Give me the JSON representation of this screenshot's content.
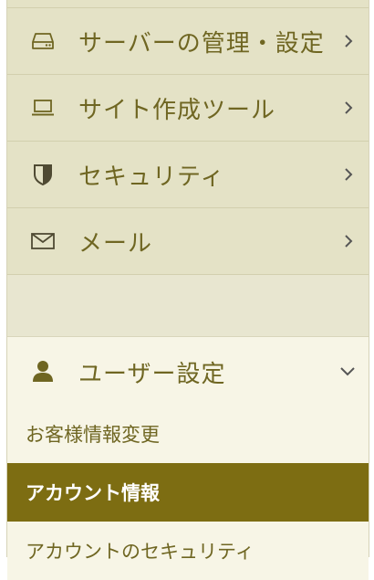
{
  "menu": {
    "items": [
      {
        "label": "サーバーの管理・設定",
        "icon": "server-icon"
      },
      {
        "label": "サイト作成ツール",
        "icon": "laptop-icon"
      },
      {
        "label": "セキュリティ",
        "icon": "shield-icon"
      },
      {
        "label": "メール",
        "icon": "mail-icon"
      }
    ],
    "user_settings": {
      "label": "ユーザー設定",
      "icon": "user-icon",
      "sub_items": [
        {
          "label": "お客様情報変更",
          "active": false
        },
        {
          "label": "アカウント情報",
          "active": true
        },
        {
          "label": "アカウントのセキュリティ",
          "active": false
        }
      ]
    }
  },
  "colors": {
    "text": "#6f6622",
    "active_bg": "#7d6d12",
    "menu_bg": "#e4e2c6",
    "expanded_bg": "#f7f5e6"
  }
}
